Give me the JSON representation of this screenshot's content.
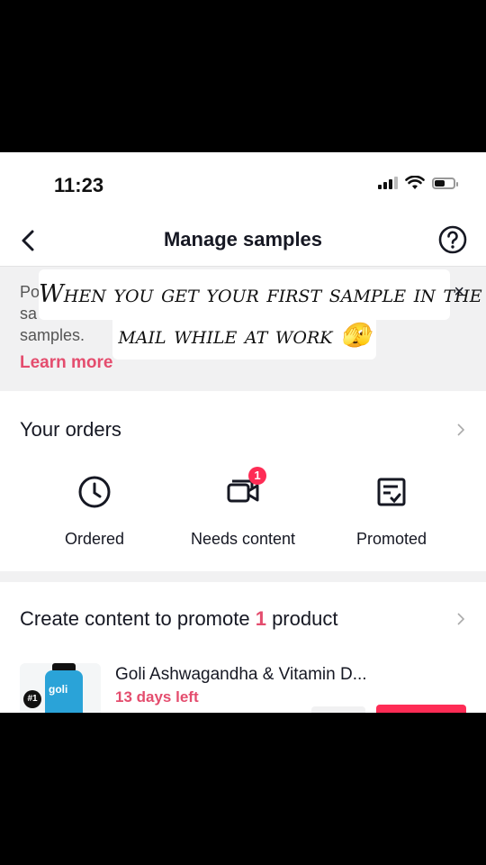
{
  "status_bar": {
    "time": "11:23"
  },
  "header": {
    "title": "Manage samples",
    "back_icon": "chevron-left-icon",
    "help_icon": "question-circle-icon"
  },
  "banner": {
    "text_line1": "Po",
    "text_line2": "sa",
    "text_line3": "samples.",
    "link": "Learn more",
    "close": "×"
  },
  "caption": {
    "line1": "When you get your first sample in the",
    "line2": "mail while at work 🫣"
  },
  "orders": {
    "title": "Your orders",
    "items": [
      {
        "label": "Ordered",
        "icon": "clock-icon"
      },
      {
        "label": "Needs content",
        "icon": "video-icon",
        "badge": "1"
      },
      {
        "label": "Promoted",
        "icon": "checklist-icon"
      }
    ]
  },
  "promote": {
    "title_prefix": "Create content to promote ",
    "count": "1",
    "title_suffix": " product",
    "product": {
      "name": "Goli Ashwagandha & Vitamin D...",
      "days_left": "13 days left",
      "brand": "goli",
      "badge": "#1"
    }
  },
  "colors": {
    "accent": "#e44d6e",
    "primary": "#fe2c55",
    "text": "#161823"
  }
}
